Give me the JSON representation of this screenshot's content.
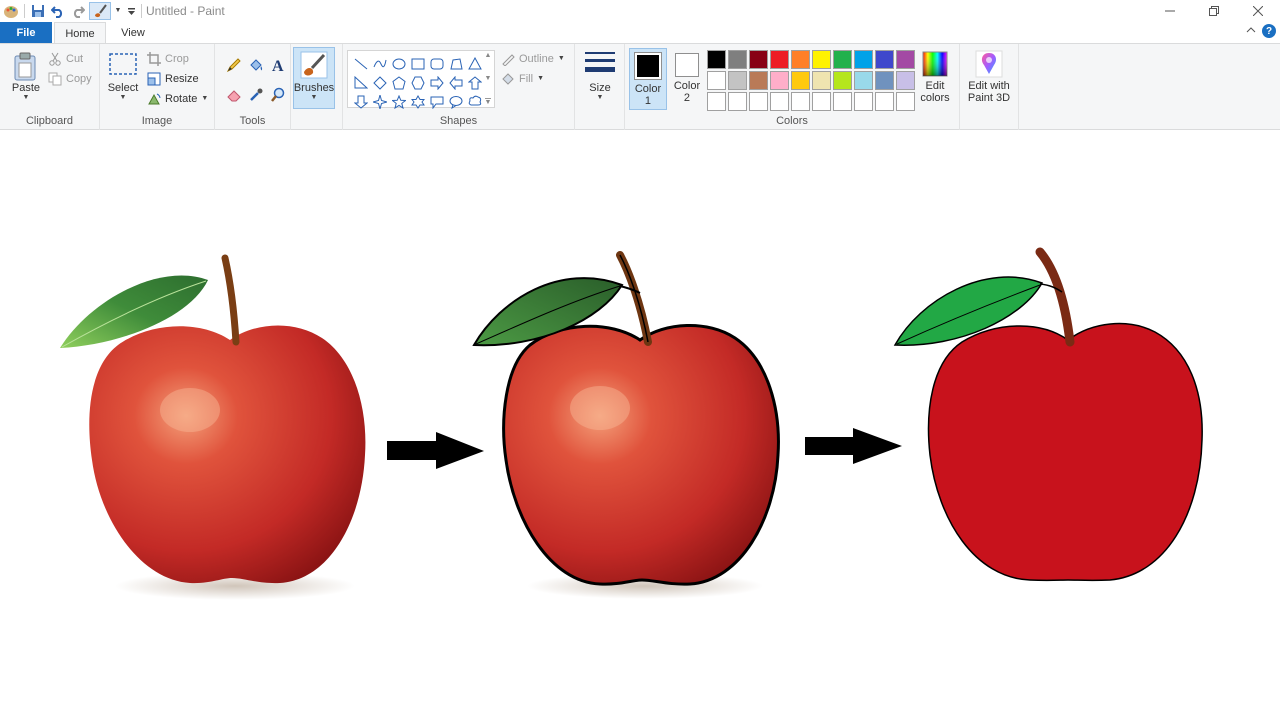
{
  "window": {
    "title": "Untitled - Paint",
    "controls": [
      "minimize-icon",
      "restore-icon",
      "close-icon"
    ]
  },
  "quick_access": [
    "paint-app-icon",
    "save-icon",
    "undo-icon",
    "redo-icon",
    "brushes-icon",
    "customize-dropdown-icon"
  ],
  "tabs": {
    "file": "File",
    "home": "Home",
    "view": "View",
    "active": "Home"
  },
  "ribbon": {
    "clipboard": {
      "label": "Clipboard",
      "paste": "Paste",
      "cut": "Cut",
      "copy": "Copy"
    },
    "image": {
      "label": "Image",
      "select": "Select",
      "crop": "Crop",
      "resize": "Resize",
      "rotate": "Rotate"
    },
    "tools": {
      "label": "Tools",
      "items": [
        "pencil-icon",
        "fill-bucket-icon",
        "text-icon",
        "eraser-icon",
        "color-picker-icon",
        "magnifier-icon"
      ]
    },
    "brushes": {
      "label": "Brushes"
    },
    "shapes": {
      "label": "Shapes",
      "outline": "Outline",
      "fill": "Fill"
    },
    "size": {
      "label": "Size"
    },
    "colors": {
      "label": "Colors",
      "color1": "Color\n1",
      "color2": "Color\n2",
      "color1_value": "#000000",
      "color2_value": "#ffffff",
      "edit_colors": "Edit\ncolors",
      "palette": [
        "#000000",
        "#7f7f7f",
        "#880015",
        "#ed1c24",
        "#ff7f27",
        "#fff200",
        "#22b14c",
        "#00a2e8",
        "#3f48cc",
        "#a349a4",
        "#ffffff",
        "#c3c3c3",
        "#b97a57",
        "#ffaec9",
        "#ffc90e",
        "#efe4b0",
        "#b5e61d",
        "#99d9ea",
        "#7092be",
        "#c8bfe7",
        "#ffffff",
        "#ffffff",
        "#ffffff",
        "#ffffff",
        "#ffffff",
        "#ffffff",
        "#ffffff",
        "#ffffff",
        "#ffffff",
        "#ffffff"
      ]
    },
    "paint3d": {
      "label": "Edit with\nPaint 3D"
    }
  },
  "canvas": {
    "image_elements": [
      "realistic-apple",
      "arrow-right",
      "outlined-apple",
      "arrow-right",
      "flat-red-apple"
    ],
    "apple_red": "#c8121c",
    "leaf_green": "#22a845"
  }
}
